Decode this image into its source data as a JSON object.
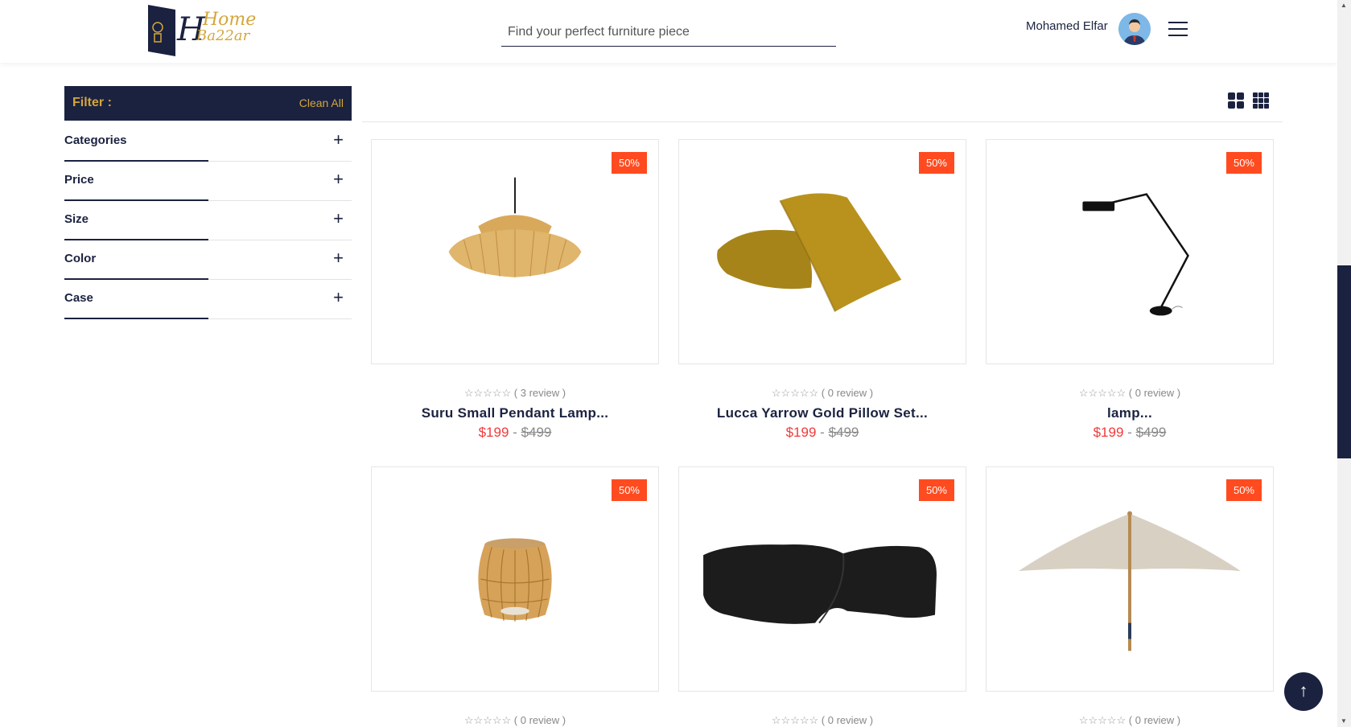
{
  "header": {
    "logo_line1": "Home",
    "logo_line2": "Ba22ar",
    "logo_letter": "H",
    "search_placeholder": "Find your perfect furniture piece",
    "user_name": "Mohamed Elfar"
  },
  "filter": {
    "title": "Filter :",
    "clean_label": "Clean All",
    "items": [
      {
        "label": "Categories"
      },
      {
        "label": "Price"
      },
      {
        "label": "Size"
      },
      {
        "label": "Color"
      },
      {
        "label": "Case"
      }
    ]
  },
  "products": [
    {
      "badge": "50%",
      "stars": "☆☆☆☆☆",
      "reviews": "( 3 review )",
      "name": "Suru Small Pendant Lamp...",
      "price": "$199",
      "old_price": "$499"
    },
    {
      "badge": "50%",
      "stars": "☆☆☆☆☆",
      "reviews": "( 0 review )",
      "name": "Lucca Yarrow Gold Pillow Set...",
      "price": "$199",
      "old_price": "$499"
    },
    {
      "badge": "50%",
      "stars": "☆☆☆☆☆",
      "reviews": "( 0 review )",
      "name": "lamp...",
      "price": "$199",
      "old_price": "$499"
    },
    {
      "badge": "50%",
      "stars": "☆☆☆☆☆",
      "reviews": "( 0 review )",
      "name": "",
      "price": "",
      "old_price": ""
    },
    {
      "badge": "50%",
      "stars": "☆☆☆☆☆",
      "reviews": "( 0 review )",
      "name": "",
      "price": "",
      "old_price": ""
    },
    {
      "badge": "50%",
      "stars": "☆☆☆☆☆",
      "reviews": "( 0 review )",
      "name": "",
      "price": "",
      "old_price": ""
    }
  ],
  "price_separator": "-",
  "icons": {
    "menu": "hamburger-menu-icon",
    "plus": "plus-icon",
    "grid_2": "grid-2-icon",
    "grid_3": "grid-3-icon",
    "to_top": "arrow-up-icon"
  },
  "colors": {
    "navy": "#1b2240",
    "gold": "#d4a63a",
    "badge": "#ff4b1f",
    "price": "#f03a3a"
  }
}
